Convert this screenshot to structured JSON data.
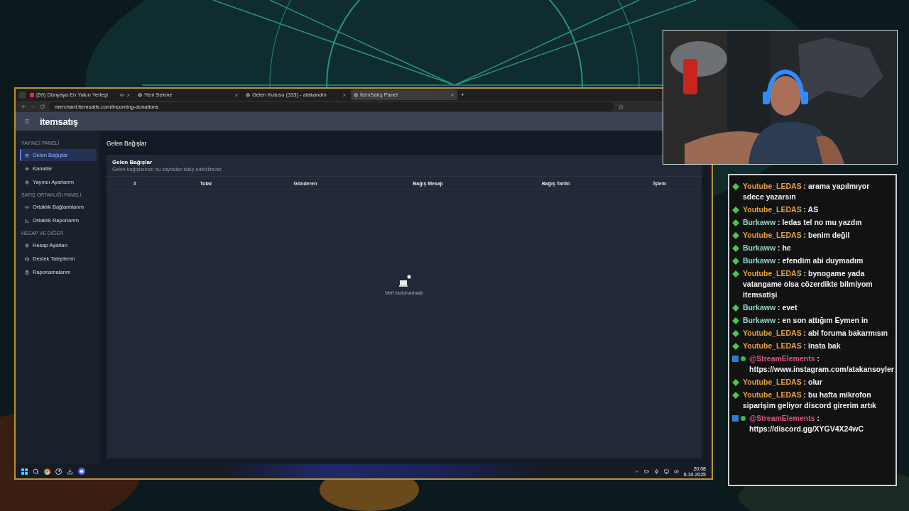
{
  "browser": {
    "tabs": [
      {
        "title": "(59) Dünyaya En Yakın Yerleşi",
        "selected": false,
        "audio": true
      },
      {
        "title": "Yeni Sekme",
        "selected": false,
        "audio": false
      },
      {
        "title": "Gelen Kutusu (333) - atakandm",
        "selected": false,
        "audio": false
      },
      {
        "title": "İtemSatış Panel",
        "selected": true,
        "audio": false
      }
    ],
    "new_tab": "+",
    "url": "merchant.itemsatis.com/incoming-donations"
  },
  "app": {
    "logo": "itemsatış",
    "sidebar": {
      "sections": [
        {
          "title": "YAYINCI PANELİ",
          "items": [
            {
              "label": "Gelen Bağışlar",
              "selected": true
            },
            {
              "label": "Kanallar",
              "selected": false
            },
            {
              "label": "Yayıncı Ayarlarım",
              "selected": false
            }
          ]
        },
        {
          "title": "SATIŞ ORTAKLIĞI PANELİ",
          "items": [
            {
              "label": "Ortaklık Bağlantılarım",
              "selected": false
            },
            {
              "label": "Ortaklık Raporlarım",
              "selected": false
            }
          ]
        },
        {
          "title": "HESAP VE DİĞER",
          "items": [
            {
              "label": "Hesap Ayarları",
              "selected": false
            },
            {
              "label": "Destek Taleplerim",
              "selected": false
            },
            {
              "label": "Raporlamalarım",
              "selected": false
            }
          ]
        }
      ]
    },
    "page_title": "Gelen Bağışlar",
    "card": {
      "title": "Gelen Bağışlar",
      "subtitle": "Gelen bağışlarınızı bu sayfadan takip edebilirsiniz",
      "columns": [
        "#",
        "Tutar",
        "Gönderen",
        "Bağış Mesajı",
        "Bağış Tarihi",
        "İşlem"
      ],
      "empty_text": "Veri bulunamadı"
    }
  },
  "taskbar": {
    "time": "20:08",
    "date": "6.10.2025"
  },
  "chat": {
    "messages": [
      {
        "kind": "user",
        "user": "Youtube_LEDAS",
        "color": "#e6a23c",
        "text": " : arama yapılmıyor sdece yazarsın"
      },
      {
        "kind": "user",
        "user": "Youtube_LEDAS",
        "color": "#e6a23c",
        "text": " : AS"
      },
      {
        "kind": "user",
        "user": "Burkaww",
        "color": "#8fd6c4",
        "text": " : ledas tel no mu yazdın"
      },
      {
        "kind": "user",
        "user": "Youtube_LEDAS",
        "color": "#e6a23c",
        "text": " : benim değil"
      },
      {
        "kind": "user",
        "user": "Burkaww",
        "color": "#8fd6c4",
        "text": " : he"
      },
      {
        "kind": "user",
        "user": "Burkaww",
        "color": "#8fd6c4",
        "text": " : efendim abi duymadım"
      },
      {
        "kind": "user",
        "user": "Youtube_LEDAS",
        "color": "#e6a23c",
        "text": " : bynogame yada vatangame olsa cözerdikte bilmiyom itemsatişi"
      },
      {
        "kind": "user",
        "user": "Burkaww",
        "color": "#8fd6c4",
        "text": " : evet"
      },
      {
        "kind": "user",
        "user": "Burkaww",
        "color": "#8fd6c4",
        "text": " : en son attığım Eymen in"
      },
      {
        "kind": "user",
        "user": "Youtube_LEDAS",
        "color": "#e6a23c",
        "text": " : abi foruma bakarmısın"
      },
      {
        "kind": "user",
        "user": "Youtube_LEDAS",
        "color": "#e6a23c",
        "text": " : insta bak"
      },
      {
        "kind": "bot",
        "user": "@StreamElements",
        "color": "#d9577f",
        "text": " : https://www.instagram.com/atakansoyler"
      },
      {
        "kind": "user",
        "user": "Youtube_LEDAS",
        "color": "#e6a23c",
        "text": " : olur"
      },
      {
        "kind": "user",
        "user": "Youtube_LEDAS",
        "color": "#e6a23c",
        "text": " : bu hafta mikrofon siparişim geliyor discord girerim artık"
      },
      {
        "kind": "bot",
        "user": "@StreamElements",
        "color": "#d9577f",
        "text": " : https://discord.gg/XYGV4X24wC"
      }
    ]
  }
}
